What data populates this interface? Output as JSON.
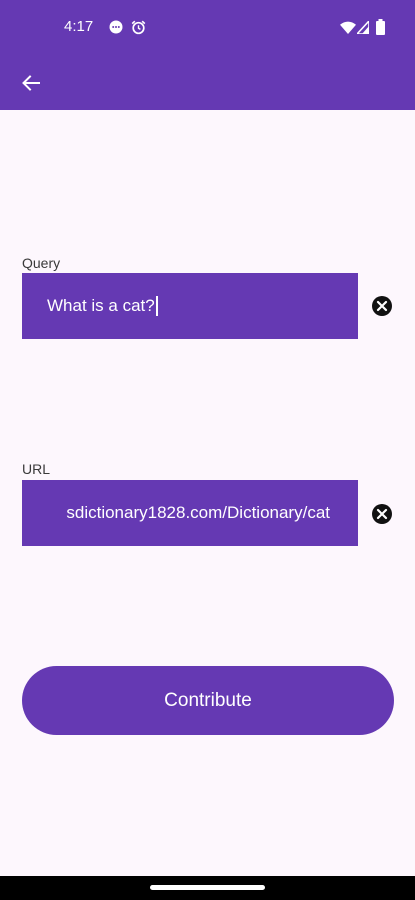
{
  "status_bar": {
    "time": "4:17",
    "icons": [
      "message-icon",
      "alarm-icon",
      "wifi-icon",
      "signal-icon",
      "battery-icon"
    ]
  },
  "app_bar": {
    "back_icon": "arrow-left-icon"
  },
  "form": {
    "query_label": "Query",
    "query_value": "What is a cat?",
    "url_label": "URL",
    "url_value": "sdictionary1828.com/Dictionary/cat",
    "clear_icon": "close-circle-icon"
  },
  "contribute_label": "Contribute",
  "colors": {
    "primary": "#6539B3",
    "background": "#FDF7FD",
    "on_primary": "#FFFFFF"
  }
}
